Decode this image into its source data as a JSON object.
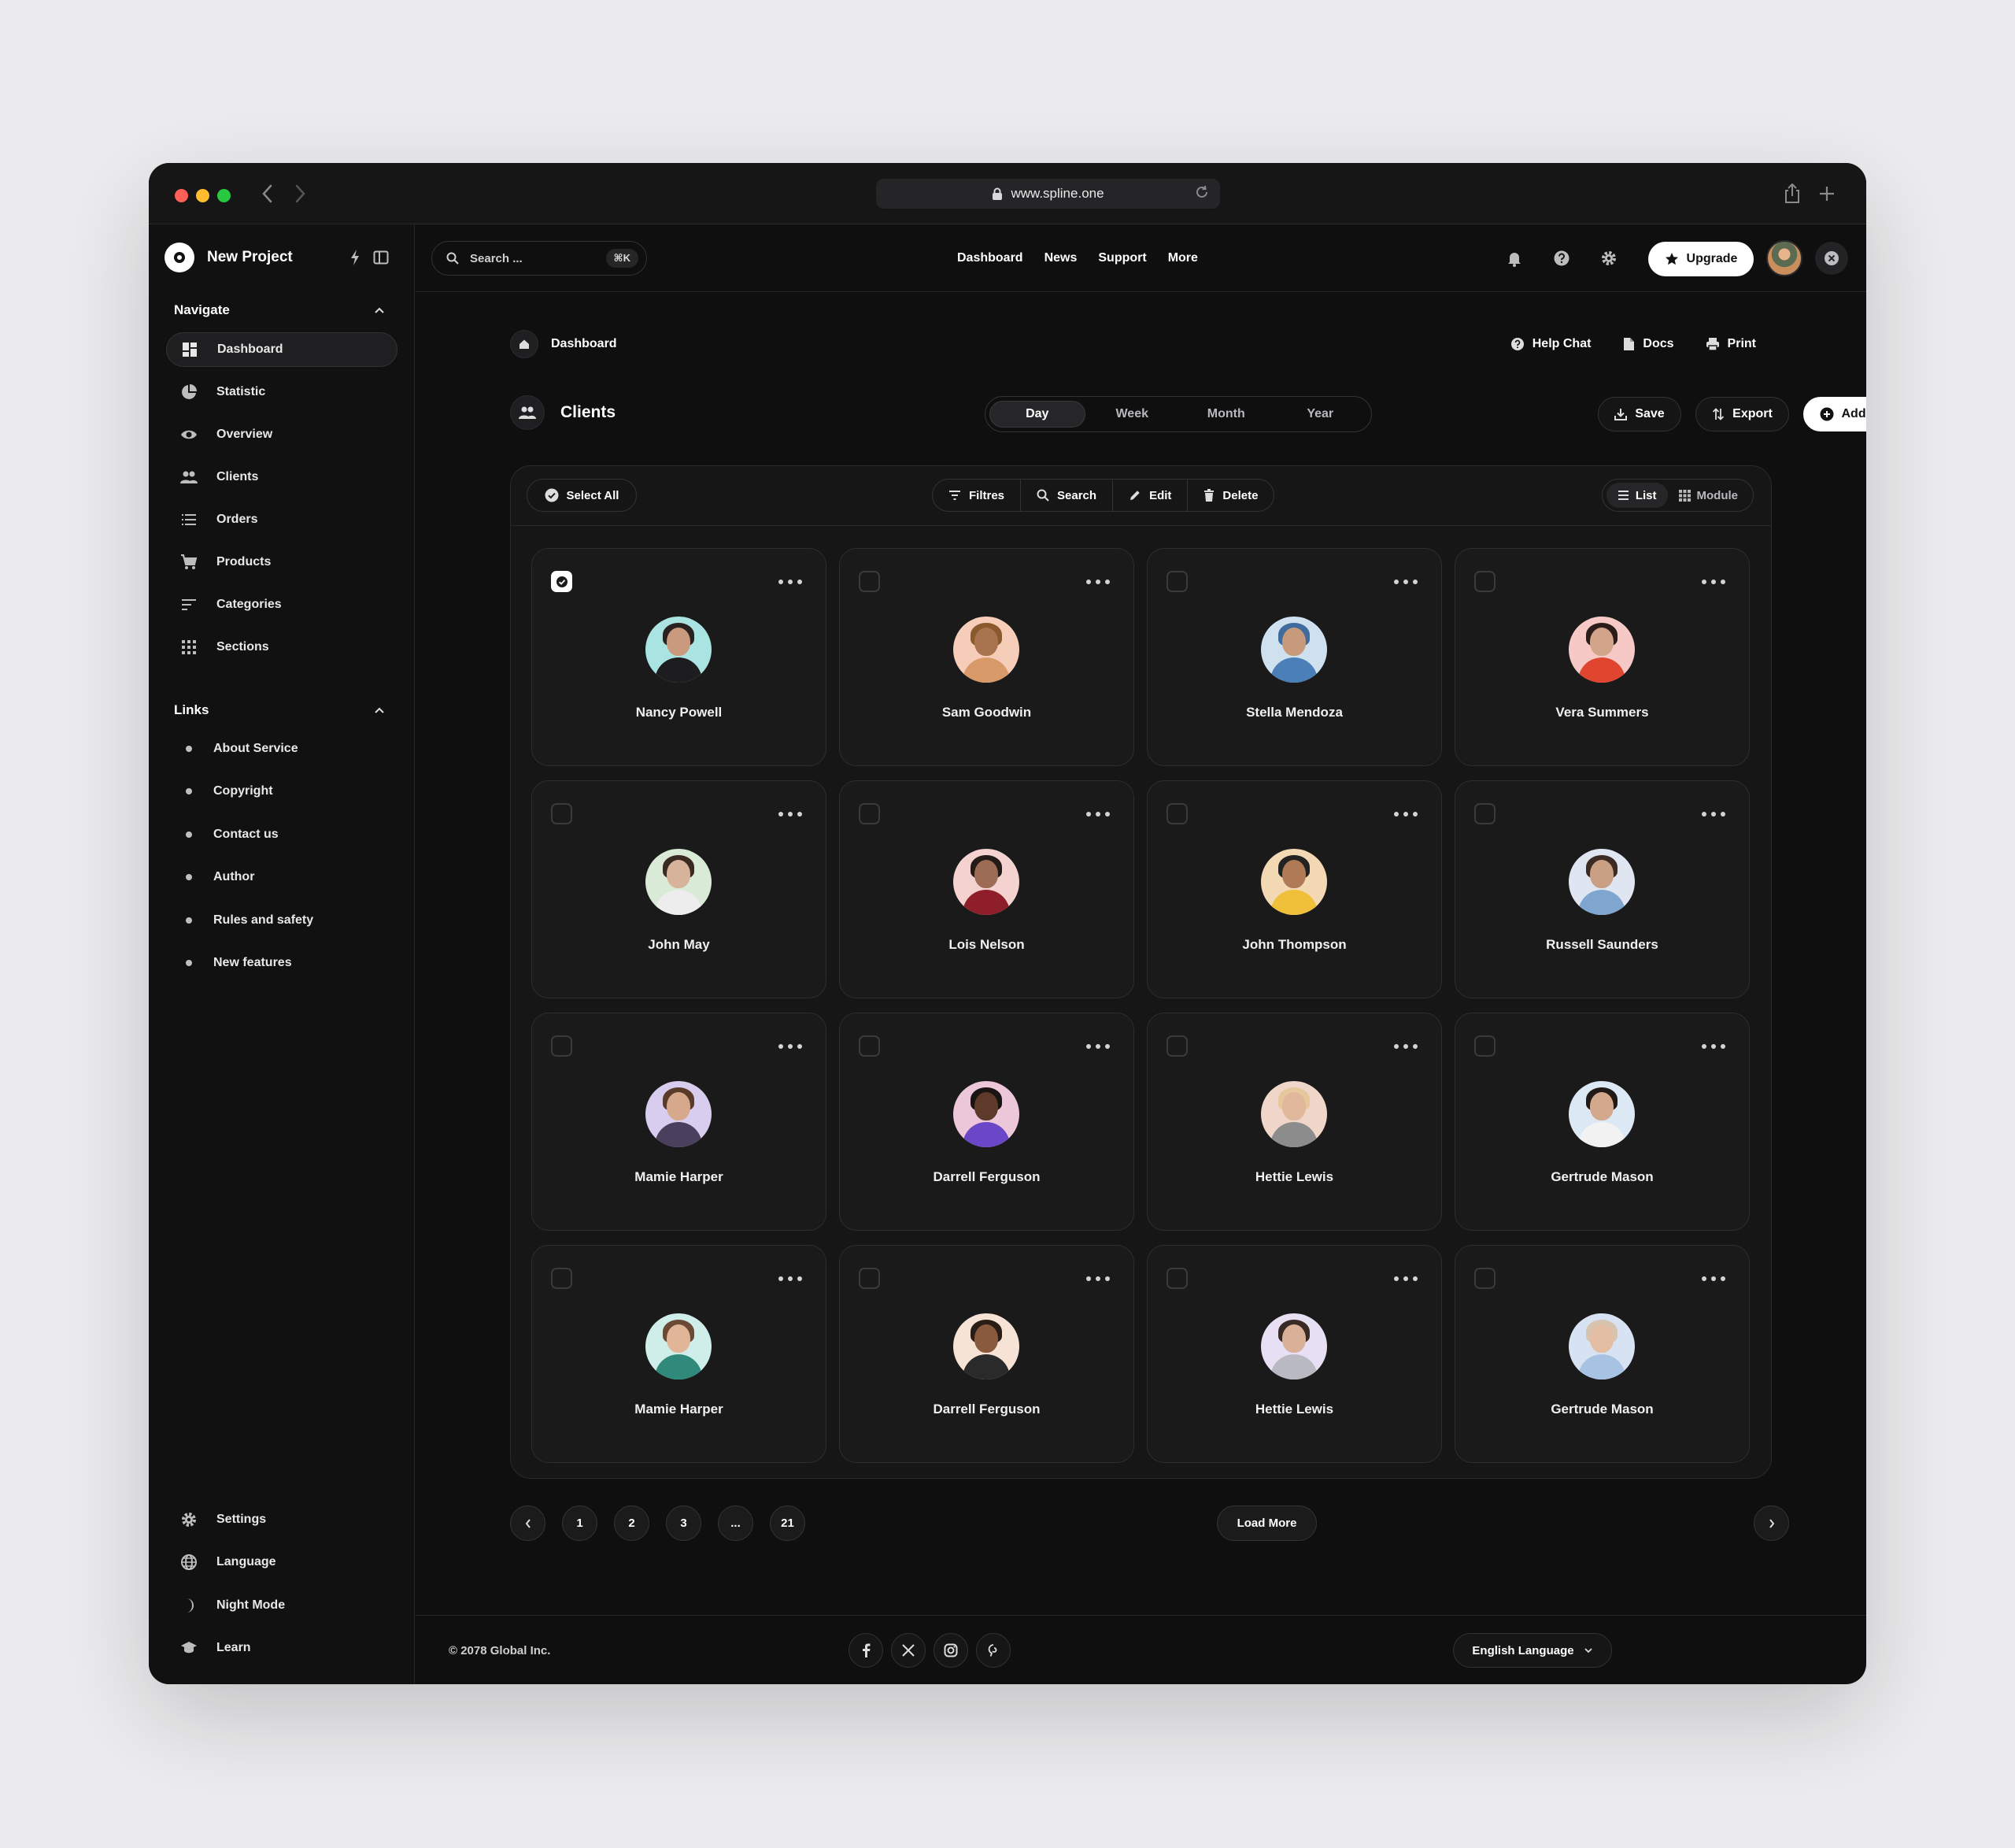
{
  "browser": {
    "url": "www.spline.one"
  },
  "sidebar": {
    "project_name": "New Project",
    "navigate_title": "Navigate",
    "nav_items": [
      {
        "label": "Dashboard",
        "icon": "dashboard-icon",
        "active": true
      },
      {
        "label": "Statistic",
        "icon": "pie-chart-icon"
      },
      {
        "label": "Overview",
        "icon": "eye-icon"
      },
      {
        "label": "Clients",
        "icon": "users-icon"
      },
      {
        "label": "Orders",
        "icon": "list-icon"
      },
      {
        "label": "Products",
        "icon": "cart-icon"
      },
      {
        "label": "Categories",
        "icon": "sort-icon"
      },
      {
        "label": "Sections",
        "icon": "grid-icon"
      }
    ],
    "links_title": "Links",
    "links": [
      "About Service",
      "Copyright",
      "Contact us",
      "Author",
      "Rules and safety",
      "New features"
    ],
    "bottom_items": [
      {
        "label": "Settings",
        "icon": "gear-icon"
      },
      {
        "label": "Language",
        "icon": "globe-icon"
      },
      {
        "label": "Night Mode",
        "icon": "moon-icon"
      },
      {
        "label": "Learn",
        "icon": "graduation-cap-icon"
      }
    ]
  },
  "topbar": {
    "search_placeholder": "Search ...",
    "search_shortcut": "⌘K",
    "nav": [
      "Dashboard",
      "News",
      "Support",
      "More"
    ],
    "upgrade_label": "Upgrade"
  },
  "page": {
    "breadcrumb": "Dashboard",
    "help_chat": "Help Chat",
    "docs": "Docs",
    "print": "Print",
    "title": "Clients",
    "periods": [
      "Day",
      "Week",
      "Month",
      "Year"
    ],
    "active_period": "Day",
    "save_label": "Save",
    "export_label": "Export",
    "add_client_label": "Add Client"
  },
  "toolbar": {
    "select_all": "Select All",
    "filters": "Filtres",
    "search": "Search",
    "edit": "Edit",
    "delete": "Delete",
    "view_list": "List",
    "view_module": "Module",
    "active_view": "List"
  },
  "clients": [
    {
      "name": "Nancy Powell",
      "checked": true,
      "bg": "#a9e4e2",
      "hair": "#2a2220",
      "skin": "#c99a7e",
      "shirt": "#1d1d1f"
    },
    {
      "name": "Sam Goodwin",
      "checked": false,
      "bg": "#f6cdb8",
      "hair": "#8a5a2c",
      "skin": "#a8734f",
      "shirt": "#d99a6a"
    },
    {
      "name": "Stella Mendoza",
      "checked": false,
      "bg": "#cfe0ef",
      "hair": "#3f6c9d",
      "skin": "#c89a7c",
      "shirt": "#4a7fb8"
    },
    {
      "name": "Vera Summers",
      "checked": false,
      "bg": "#f6c9c6",
      "hair": "#2a1d1a",
      "skin": "#d2a489",
      "shirt": "#e0452f"
    },
    {
      "name": "John May",
      "checked": false,
      "bg": "#d9ead6",
      "hair": "#3a2a22",
      "skin": "#d7b39b",
      "shirt": "#ededed"
    },
    {
      "name": "Lois Nelson",
      "checked": false,
      "bg": "#f3d2cf",
      "hair": "#241a17",
      "skin": "#9c6d54",
      "shirt": "#8e1f2a"
    },
    {
      "name": "John Thompson",
      "checked": false,
      "bg": "#f3d9b3",
      "hair": "#222",
      "skin": "#b07a57",
      "shirt": "#f1c03a"
    },
    {
      "name": "Russell Saunders",
      "checked": false,
      "bg": "#dfe6f2",
      "hair": "#3b2b22",
      "skin": "#caa084",
      "shirt": "#7fa6cf"
    },
    {
      "name": "Mamie Harper",
      "checked": false,
      "bg": "#d8cdef",
      "hair": "#5a3b2a",
      "skin": "#d6a98c",
      "shirt": "#4a3f5c"
    },
    {
      "name": "Darrell Ferguson",
      "checked": false,
      "bg": "#ecc6d9",
      "hair": "#1a1412",
      "skin": "#5e3a2a",
      "shirt": "#6a47c7"
    },
    {
      "name": "Hettie Lewis",
      "checked": false,
      "bg": "#efd6c8",
      "hair": "#e7c79c",
      "skin": "#e1b89c",
      "shirt": "#8c8c8c"
    },
    {
      "name": "Gertrude Mason",
      "checked": false,
      "bg": "#dce9f4",
      "hair": "#221a17",
      "skin": "#d3a88d",
      "shirt": "#f2f2f2"
    },
    {
      "name": "Mamie Harper",
      "checked": false,
      "bg": "#cfeee9",
      "hair": "#6a4a34",
      "skin": "#e0b598",
      "shirt": "#2f8a7c"
    },
    {
      "name": "Darrell Ferguson",
      "checked": false,
      "bg": "#f6e3d6",
      "hair": "#2a1d16",
      "skin": "#8a5a3e",
      "shirt": "#2a2a2a"
    },
    {
      "name": "Hettie Lewis",
      "checked": false,
      "bg": "#e7dff3",
      "hair": "#3a2a26",
      "skin": "#d9b199",
      "shirt": "#b9b9c2"
    },
    {
      "name": "Gertrude Mason",
      "checked": false,
      "bg": "#d7e2f3",
      "hair": "#d6c3b0",
      "skin": "#e3bea3",
      "shirt": "#a8c2e4"
    }
  ],
  "pagination": {
    "pages": [
      "1",
      "2",
      "3",
      "...",
      "21"
    ],
    "load_more": "Load More"
  },
  "footer": {
    "copyright": "© 2078 Global Inc.",
    "language": "English Language"
  }
}
